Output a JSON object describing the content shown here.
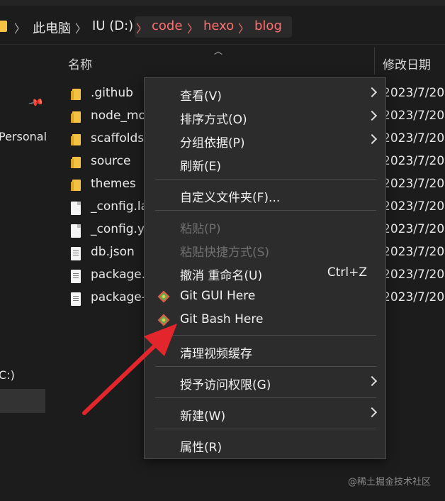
{
  "address": {
    "crumbs": [
      "此电脑",
      "IU (D:)",
      "code",
      "hexo",
      "blog"
    ]
  },
  "nav": {
    "items": [
      {
        "label": "Personal"
      },
      {
        "label": "C:)"
      }
    ]
  },
  "columns": {
    "name": "名称",
    "date": "修改日期"
  },
  "files": [
    {
      "name": ".github",
      "type": "folder",
      "date": "2023/7/20"
    },
    {
      "name": "node_mo",
      "type": "folder",
      "date": "2023/7/20"
    },
    {
      "name": "scaffolds",
      "type": "folder",
      "date": "2023/7/20"
    },
    {
      "name": "source",
      "type": "folder",
      "date": "2023/7/20"
    },
    {
      "name": "themes",
      "type": "folder",
      "date": "2023/7/20"
    },
    {
      "name": "_config.la",
      "type": "file",
      "date": "2023/7/20"
    },
    {
      "name": "_config.y",
      "type": "file",
      "date": "2023/7/20"
    },
    {
      "name": "db.json",
      "type": "doc",
      "date": "2023/7/20"
    },
    {
      "name": "package.",
      "type": "doc",
      "date": "2023/7/20"
    },
    {
      "name": "package-",
      "type": "doc",
      "date": "2023/7/20"
    }
  ],
  "context_menu": {
    "view": "查看(V)",
    "sort": "排序方式(O)",
    "group": "分组依据(P)",
    "refresh": "刷新(E)",
    "customize": "自定义文件夹(F)...",
    "paste": "粘贴(P)",
    "paste_shortcut": "粘贴快捷方式(S)",
    "undo": "撤消 重命名(U)",
    "undo_shortcut": "Ctrl+Z",
    "git_gui": "Git GUI Here",
    "git_bash": "Git Bash Here",
    "clear_cache": "清理视频缓存",
    "grant_access": "授予访问权限(G)",
    "new": "新建(W)",
    "properties": "属性(R)"
  },
  "watermark": "@稀土掘金技术社区",
  "colors": {
    "folder": "#f4c142",
    "path_highlight": "#ff6f6f",
    "annotation_arrow": "#e3262b",
    "menu_bg": "#2c2c2c"
  }
}
